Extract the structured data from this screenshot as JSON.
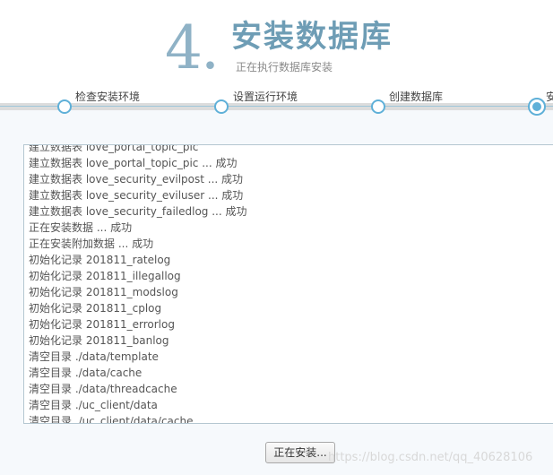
{
  "header": {
    "step_number": "4.",
    "title": "安装数据库",
    "subtitle": "正在执行数据库安装"
  },
  "steps": [
    {
      "label": "检查安装环境",
      "state": "done"
    },
    {
      "label": "设置运行环境",
      "state": "done"
    },
    {
      "label": "创建数据库",
      "state": "done"
    },
    {
      "label": "安",
      "state": "current"
    }
  ],
  "log": {
    "lines": [
      "建立数据表 love_portal_topic_pic",
      "建立数据表 love_portal_topic_pic ... 成功",
      "建立数据表 love_security_evilpost ... 成功",
      "建立数据表 love_security_eviluser ... 成功",
      "建立数据表 love_security_failedlog ... 成功",
      "正在安装数据 ... 成功",
      "正在安装附加数据 ... 成功",
      "初始化记录 201811_ratelog",
      "初始化记录 201811_illegallog",
      "初始化记录 201811_modslog",
      "初始化记录 201811_cplog",
      "初始化记录 201811_errorlog",
      "初始化记录 201811_banlog",
      "清空目录 ./data/template",
      "清空目录 ./data/cache",
      "清空目录 ./data/threadcache",
      "清空目录 ./uc_client/data",
      "清空目录 ./uc_client/data/cache"
    ]
  },
  "install_button": {
    "label": "正在安装..."
  },
  "watermark": "https://blog.csdn.net/qq_40628106",
  "colors": {
    "accent": "#6e9db5",
    "step_circle": "#5fb0d8"
  }
}
